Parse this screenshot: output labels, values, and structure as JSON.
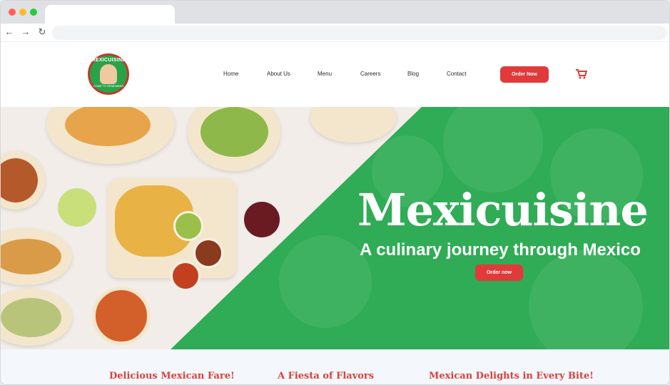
{
  "browser": {
    "tab_title": "",
    "address_value": ""
  },
  "header": {
    "logo_text": "MEXICUISINE",
    "logo_sub": "COME TO REMEMBER",
    "nav": [
      "Home",
      "About Us",
      "Menu",
      "Careers",
      "Blog",
      "Contact"
    ],
    "order_button": "Order Now",
    "cart_icon": "shopping-cart-icon",
    "accent": "#e03a3a"
  },
  "hero": {
    "title": "Mexicuisine",
    "subtitle": "A culinary journey through Mexico",
    "button": "Order now",
    "panel_color": "#2fac55"
  },
  "features": [
    "Delicious Mexican Fare!",
    "A Fiesta of Flavors",
    "Mexican Delights in Every Bite!"
  ]
}
